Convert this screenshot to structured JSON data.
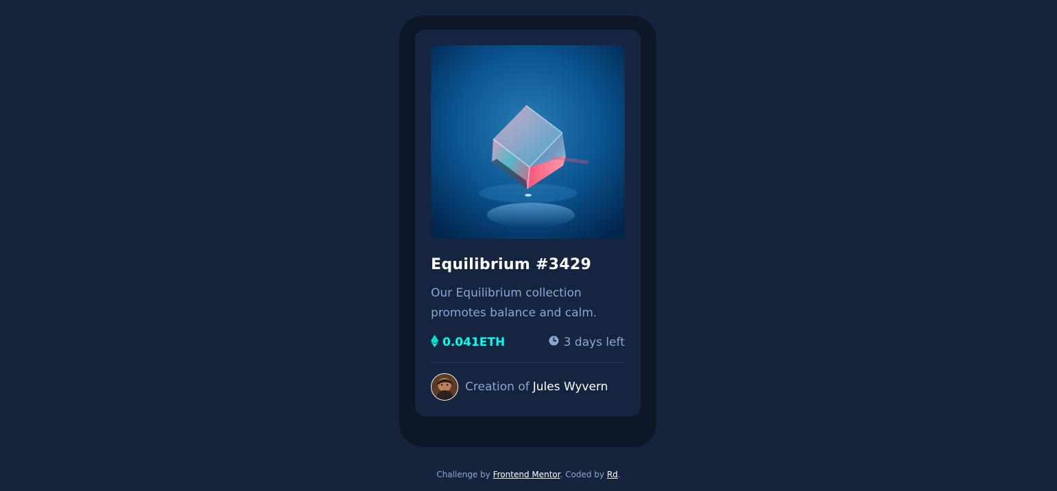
{
  "card": {
    "image_alt": "Equilibrium crystal cube",
    "title": "Equilibrium #3429",
    "description": "Our Equilibrium collection promotes balance and calm.",
    "price": "0.041ETH",
    "time_left": "3 days left",
    "creator_prefix": "Creation of",
    "creator_name": "Jules Wyvern",
    "icons": {
      "price": "ethereum-icon",
      "time": "clock-icon"
    }
  },
  "attribution": {
    "prefix": "Challenge by",
    "mentor_link": "Frontend Mentor",
    "middle": ". Coded by",
    "author_link": "Rd",
    "suffix": "."
  },
  "colors": {
    "background": "#15233d",
    "card": "#15243f",
    "frame": "#0e1728",
    "accent": "#00ffef",
    "muted_text": "#8ba7d3",
    "white": "#ffffff"
  }
}
